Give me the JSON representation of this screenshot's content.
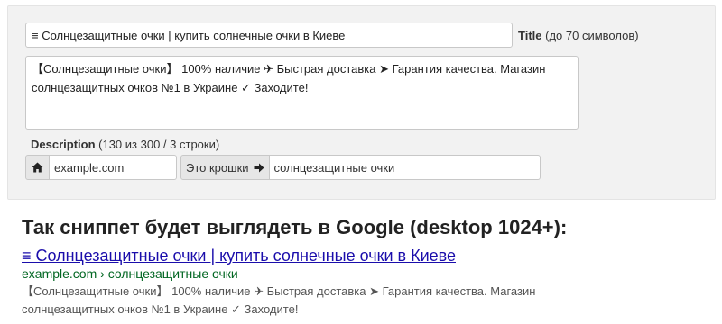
{
  "form": {
    "title_value": "≡ Солнцезащитные очки | купить солнечные очки в Киеве",
    "title_label_bold": "Title",
    "title_label_hint": "(до 70 символов)",
    "description_value": "【Солнцезащитные очки】 100% наличие ✈ Быстрая доставка ➤ Гарантия качества. Магазин солнцезащитных очков №1 в Украине ✓ Заходите!",
    "description_label_bold": "Description",
    "description_counter_open": " (",
    "description_counter_value": "130",
    "description_counter_rest": " из 300 / 3 строки)",
    "home_icon": "home-icon",
    "domain_value": "example.com",
    "crumbs_button_label": "Это крошки",
    "crumbs_arrow_icon": "arrow-right-icon",
    "crumbs_value": "солнцезащитные очки"
  },
  "preview": {
    "heading": "Так сниппет будет выглядеть в Google (desktop 1024+):",
    "serp_title": "≡ Солнцезащитные очки | купить солнечные очки в Киеве",
    "serp_url": "example.com › солнцезащитные очки",
    "serp_description": "【Солнцезащитные очки】 100% наличие ✈ Быстрая доставка ➤ Гарантия качества. Магазин солнцезащитных очков №1 в Украине ✓ Заходите!"
  },
  "colors": {
    "panel_bg": "#f2f2f2",
    "serp_link": "#1a0dab",
    "serp_url": "#006621",
    "serp_text": "#545454"
  }
}
